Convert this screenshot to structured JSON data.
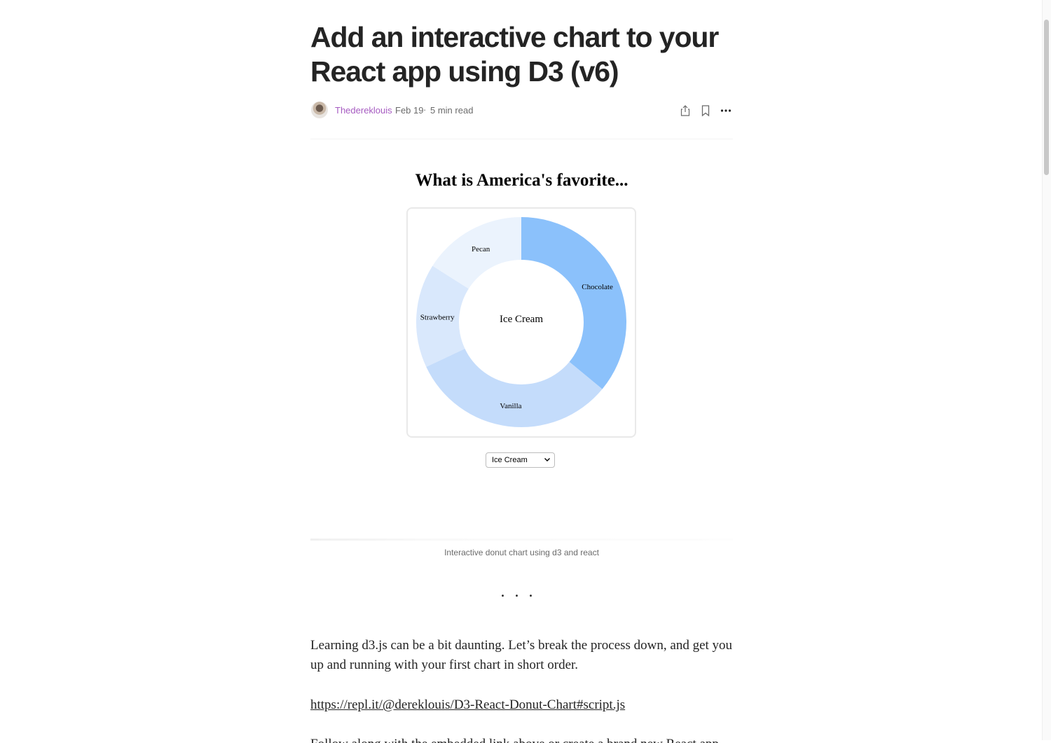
{
  "article": {
    "title": "Add an interactive chart to your React app using D3 (v6)",
    "author": "Thedereklouis",
    "date": "Feb 19",
    "separator_dot": "·",
    "read_time": "5 min read",
    "actions": {
      "share_icon": "share-icon",
      "bookmark_icon": "bookmark-icon",
      "more_icon": "more-icon"
    }
  },
  "figure": {
    "title": "What is America's favorite...",
    "center_label": "Ice Cream",
    "select_value": "Ice Cream",
    "caption": "Interactive donut chart using d3 and react"
  },
  "chart_data": {
    "type": "pie",
    "donut": true,
    "title": "What is America's favorite...",
    "center_label": "Ice Cream",
    "categories": [
      "Chocolate",
      "Vanilla",
      "Strawberry",
      "Pecan"
    ],
    "values": [
      36,
      32,
      16,
      16
    ],
    "colors": [
      "#8bc1fb",
      "#c4dcfb",
      "#d9e8fc",
      "#ebf3fd"
    ]
  },
  "body": {
    "separator": "...",
    "paragraph1": "Learning d3.js can be a bit daunting. Let’s break the process down, and get you up and running with your first chart in short order.",
    "link": "https://repl.it/@dereklouis/D3-React-Donut-Chart#script.js",
    "next_line": "Follow along with the embedded link above or create a brand new React app and"
  }
}
